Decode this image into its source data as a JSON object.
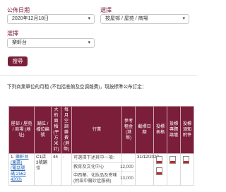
{
  "form": {
    "date_label": "公佈日期",
    "date_value": "2020年12月18日",
    "district_label": "選擇",
    "district_value": "按屋邨 / 屋苑 / 商場",
    "estate_label": "選擇",
    "estate_value": "樂軒台",
    "search_label": "搜尋"
  },
  "description": "下列商業單位的月租 (不包括差餉及空調雜費)，現按標準公布訂定：",
  "table": {
    "headers": [
      "屋邨 / 屋苑 / 商場 (地址)",
      "舖位 / 檔位編號",
      "大約面積 (平方米計)",
      "每月空調雜費 (港幣)",
      "行業",
      "參考租金 (港幣)",
      "截標日期",
      "投標表格",
      "投標專題論壇",
      "投標須知附件"
    ],
    "row": {
      "estate": "樂軒台",
      "estate_sub": "(東區)",
      "address": "(電話號碼:2562 4203)",
      "number": "1.",
      "unit": "C1店 3號舖位",
      "area": "44",
      "aircon": "-",
      "trades": [
        "可選擇下述其中一項：",
        "教育及文化中心",
        "中西藥、化妝品及寄味 (附設中醫診症服務)"
      ],
      "rents": [
        "",
        "12,000",
        "13,000"
      ],
      "closing_date": "31/12/2020"
    }
  },
  "colors": {
    "brand": "#7b1e3a"
  },
  "icons": [
    "caret-down-icon",
    "pdf-icon"
  ]
}
